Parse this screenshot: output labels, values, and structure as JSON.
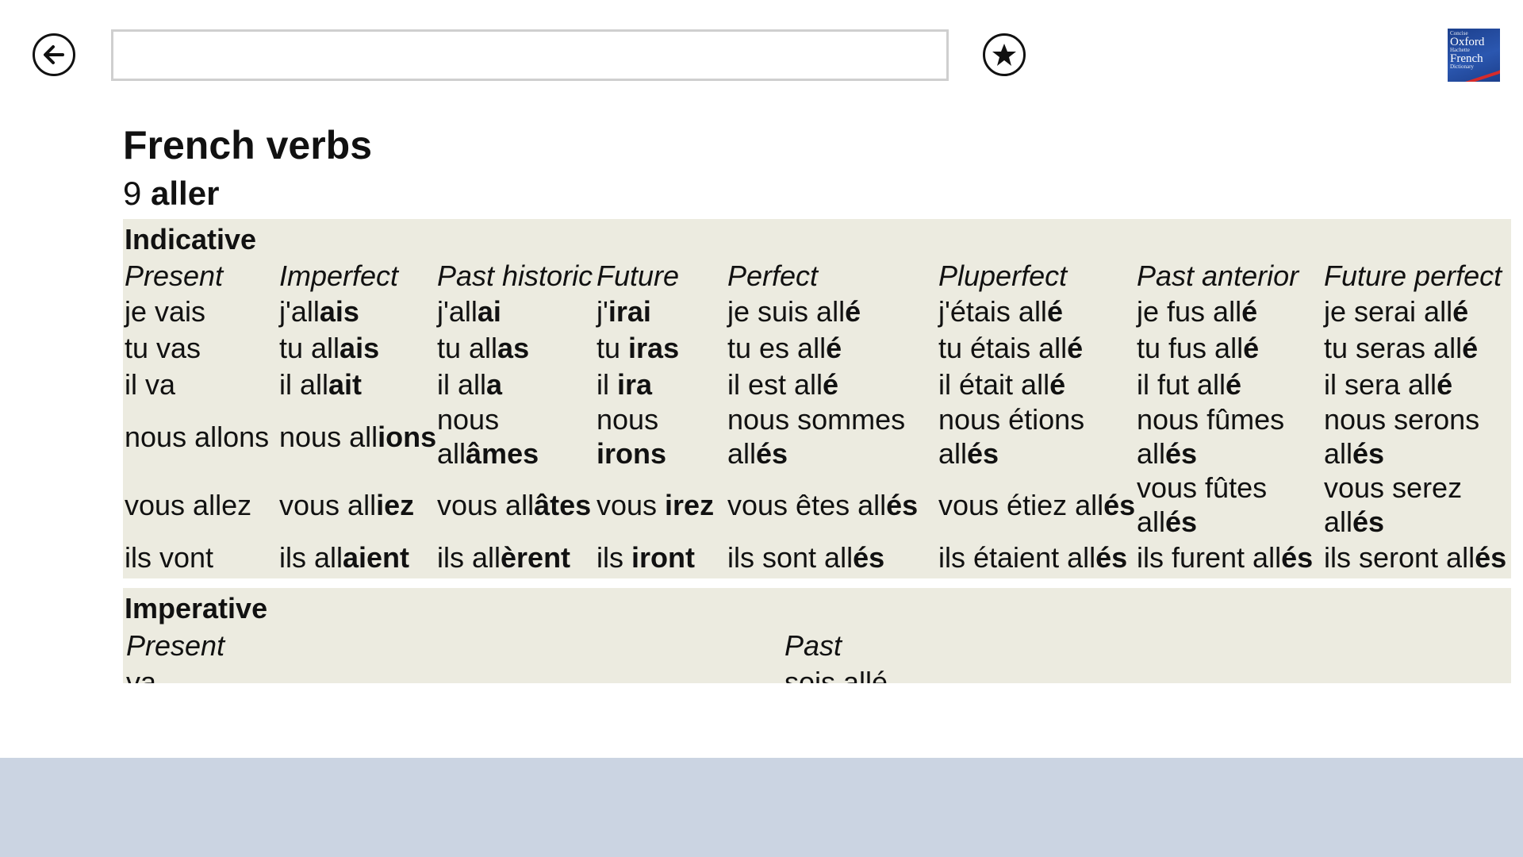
{
  "toolbar": {
    "back_icon": "back-arrow-icon",
    "search_value": "",
    "search_placeholder": "",
    "favorite_icon": "star-icon"
  },
  "logo": {
    "line1": "Concise",
    "line2": "Oxford",
    "line3": "Hachette",
    "line4": "French",
    "line5": "Dictionary"
  },
  "page": {
    "title": "French verbs",
    "verb_number": "9",
    "verb_name": "aller"
  },
  "indicative": {
    "heading": "Indicative",
    "columns": [
      "Present",
      "Imperfect",
      "Past historic",
      "Future",
      "Perfect",
      "Pluperfect",
      "Past anterior",
      "Future perfect"
    ],
    "rows": [
      [
        [
          {
            "t": "je vais",
            "b": false
          }
        ],
        [
          {
            "t": "j'all",
            "b": false
          },
          {
            "t": "ais",
            "b": true
          }
        ],
        [
          {
            "t": "j'all",
            "b": false
          },
          {
            "t": "ai",
            "b": true
          }
        ],
        [
          {
            "t": "j'",
            "b": false
          },
          {
            "t": "irai",
            "b": true
          }
        ],
        [
          {
            "t": "je suis all",
            "b": false
          },
          {
            "t": "é",
            "b": true
          }
        ],
        [
          {
            "t": "j'étais all",
            "b": false
          },
          {
            "t": "é",
            "b": true
          }
        ],
        [
          {
            "t": "je fus all",
            "b": false
          },
          {
            "t": "é",
            "b": true
          }
        ],
        [
          {
            "t": "je serai all",
            "b": false
          },
          {
            "t": "é",
            "b": true
          }
        ]
      ],
      [
        [
          {
            "t": "tu vas",
            "b": false
          }
        ],
        [
          {
            "t": "tu all",
            "b": false
          },
          {
            "t": "ais",
            "b": true
          }
        ],
        [
          {
            "t": "tu all",
            "b": false
          },
          {
            "t": "as",
            "b": true
          }
        ],
        [
          {
            "t": "tu ",
            "b": false
          },
          {
            "t": "iras",
            "b": true
          }
        ],
        [
          {
            "t": "tu es all",
            "b": false
          },
          {
            "t": "é",
            "b": true
          }
        ],
        [
          {
            "t": "tu étais all",
            "b": false
          },
          {
            "t": "é",
            "b": true
          }
        ],
        [
          {
            "t": "tu fus all",
            "b": false
          },
          {
            "t": "é",
            "b": true
          }
        ],
        [
          {
            "t": "tu seras all",
            "b": false
          },
          {
            "t": "é",
            "b": true
          }
        ]
      ],
      [
        [
          {
            "t": "il va",
            "b": false
          }
        ],
        [
          {
            "t": "il all",
            "b": false
          },
          {
            "t": "ait",
            "b": true
          }
        ],
        [
          {
            "t": "il all",
            "b": false
          },
          {
            "t": "a",
            "b": true
          }
        ],
        [
          {
            "t": "il ",
            "b": false
          },
          {
            "t": "ira",
            "b": true
          }
        ],
        [
          {
            "t": "il est all",
            "b": false
          },
          {
            "t": "é",
            "b": true
          }
        ],
        [
          {
            "t": "il était all",
            "b": false
          },
          {
            "t": "é",
            "b": true
          }
        ],
        [
          {
            "t": "il fut all",
            "b": false
          },
          {
            "t": "é",
            "b": true
          }
        ],
        [
          {
            "t": "il sera all",
            "b": false
          },
          {
            "t": "é",
            "b": true
          }
        ]
      ],
      [
        [
          {
            "t": "nous allons",
            "b": false
          }
        ],
        [
          {
            "t": "nous all",
            "b": false
          },
          {
            "t": "ions",
            "b": true
          }
        ],
        [
          {
            "t": "nous all",
            "b": false
          },
          {
            "t": "âmes",
            "b": true
          }
        ],
        [
          {
            "t": "nous ",
            "b": false
          },
          {
            "t": "irons",
            "b": true
          }
        ],
        [
          {
            "t": "nous sommes all",
            "b": false
          },
          {
            "t": "és",
            "b": true
          }
        ],
        [
          {
            "t": "nous étions all",
            "b": false
          },
          {
            "t": "és",
            "b": true
          }
        ],
        [
          {
            "t": "nous fûmes all",
            "b": false
          },
          {
            "t": "és",
            "b": true
          }
        ],
        [
          {
            "t": "nous serons all",
            "b": false
          },
          {
            "t": "és",
            "b": true
          }
        ]
      ],
      [
        [
          {
            "t": "vous allez",
            "b": false
          }
        ],
        [
          {
            "t": "vous all",
            "b": false
          },
          {
            "t": "iez",
            "b": true
          }
        ],
        [
          {
            "t": "vous all",
            "b": false
          },
          {
            "t": "âtes",
            "b": true
          }
        ],
        [
          {
            "t": "vous ",
            "b": false
          },
          {
            "t": "irez",
            "b": true
          }
        ],
        [
          {
            "t": "vous êtes all",
            "b": false
          },
          {
            "t": "és",
            "b": true
          }
        ],
        [
          {
            "t": "vous étiez all",
            "b": false
          },
          {
            "t": "és",
            "b": true
          }
        ],
        [
          {
            "t": "vous fûtes all",
            "b": false
          },
          {
            "t": "és",
            "b": true
          }
        ],
        [
          {
            "t": "vous serez all",
            "b": false
          },
          {
            "t": "és",
            "b": true
          }
        ]
      ],
      [
        [
          {
            "t": "ils vont",
            "b": false
          }
        ],
        [
          {
            "t": "ils all",
            "b": false
          },
          {
            "t": "aient",
            "b": true
          }
        ],
        [
          {
            "t": "ils all",
            "b": false
          },
          {
            "t": "èrent",
            "b": true
          }
        ],
        [
          {
            "t": "ils ",
            "b": false
          },
          {
            "t": "iront",
            "b": true
          }
        ],
        [
          {
            "t": "ils sont all",
            "b": false
          },
          {
            "t": "és",
            "b": true
          }
        ],
        [
          {
            "t": "ils étaient all",
            "b": false
          },
          {
            "t": "és",
            "b": true
          }
        ],
        [
          {
            "t": "ils furent all",
            "b": false
          },
          {
            "t": "és",
            "b": true
          }
        ],
        [
          {
            "t": "ils seront all",
            "b": false
          },
          {
            "t": "és",
            "b": true
          }
        ]
      ]
    ]
  },
  "imperative": {
    "heading": "Imperative",
    "present_label": "Present",
    "past_label": "Past",
    "present_first": "va",
    "past_first": "sois allé"
  }
}
